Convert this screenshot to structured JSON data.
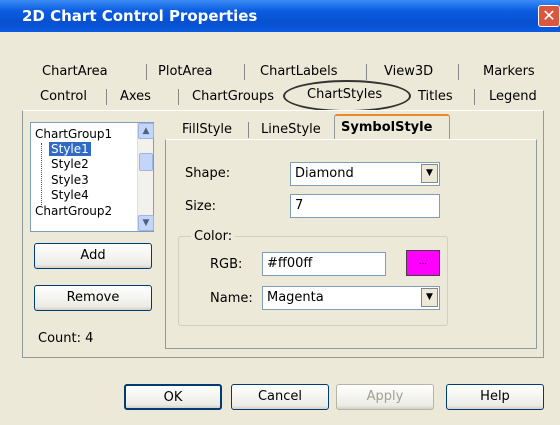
{
  "window": {
    "title": "2D Chart Control Properties",
    "close_glyph": "✕"
  },
  "tabs_row1": [
    "ChartArea",
    "PlotArea",
    "ChartLabels",
    "View3D",
    "Markers"
  ],
  "tabs_row2": [
    "Control",
    "Axes",
    "ChartGroups",
    "ChartStyles",
    "Titles",
    "Legend"
  ],
  "selected_tab": "ChartStyles",
  "tree": {
    "group1": "ChartGroup1",
    "styles": [
      "Style1",
      "Style2",
      "Style3",
      "Style4"
    ],
    "group2": "ChartGroup2",
    "selected": "Style1"
  },
  "buttons": {
    "add": "Add",
    "remove": "Remove",
    "ok": "OK",
    "cancel": "Cancel",
    "apply": "Apply",
    "help": "Help"
  },
  "count_label": "Count: 4",
  "subtabs": [
    "FillStyle",
    "LineStyle",
    "SymbolStyle"
  ],
  "selected_subtab": "SymbolStyle",
  "fields": {
    "shape_label": "Shape:",
    "shape_value": "Diamond",
    "size_label": "Size:",
    "size_value": "7",
    "color_group": "Color:",
    "rgb_label": "RGB:",
    "rgb_value": "#ff00ff",
    "swatch_glyph": "...",
    "name_label": "Name:",
    "name_value": "Magenta"
  },
  "colors": {
    "swatch": "#ff00ff",
    "title_bar": "#0A5CE0",
    "selection": "#316AC5"
  },
  "icons": {
    "dropdown": "chevron-down-icon",
    "scroll_up": "chevron-up-icon",
    "scroll_down": "chevron-down-icon"
  }
}
